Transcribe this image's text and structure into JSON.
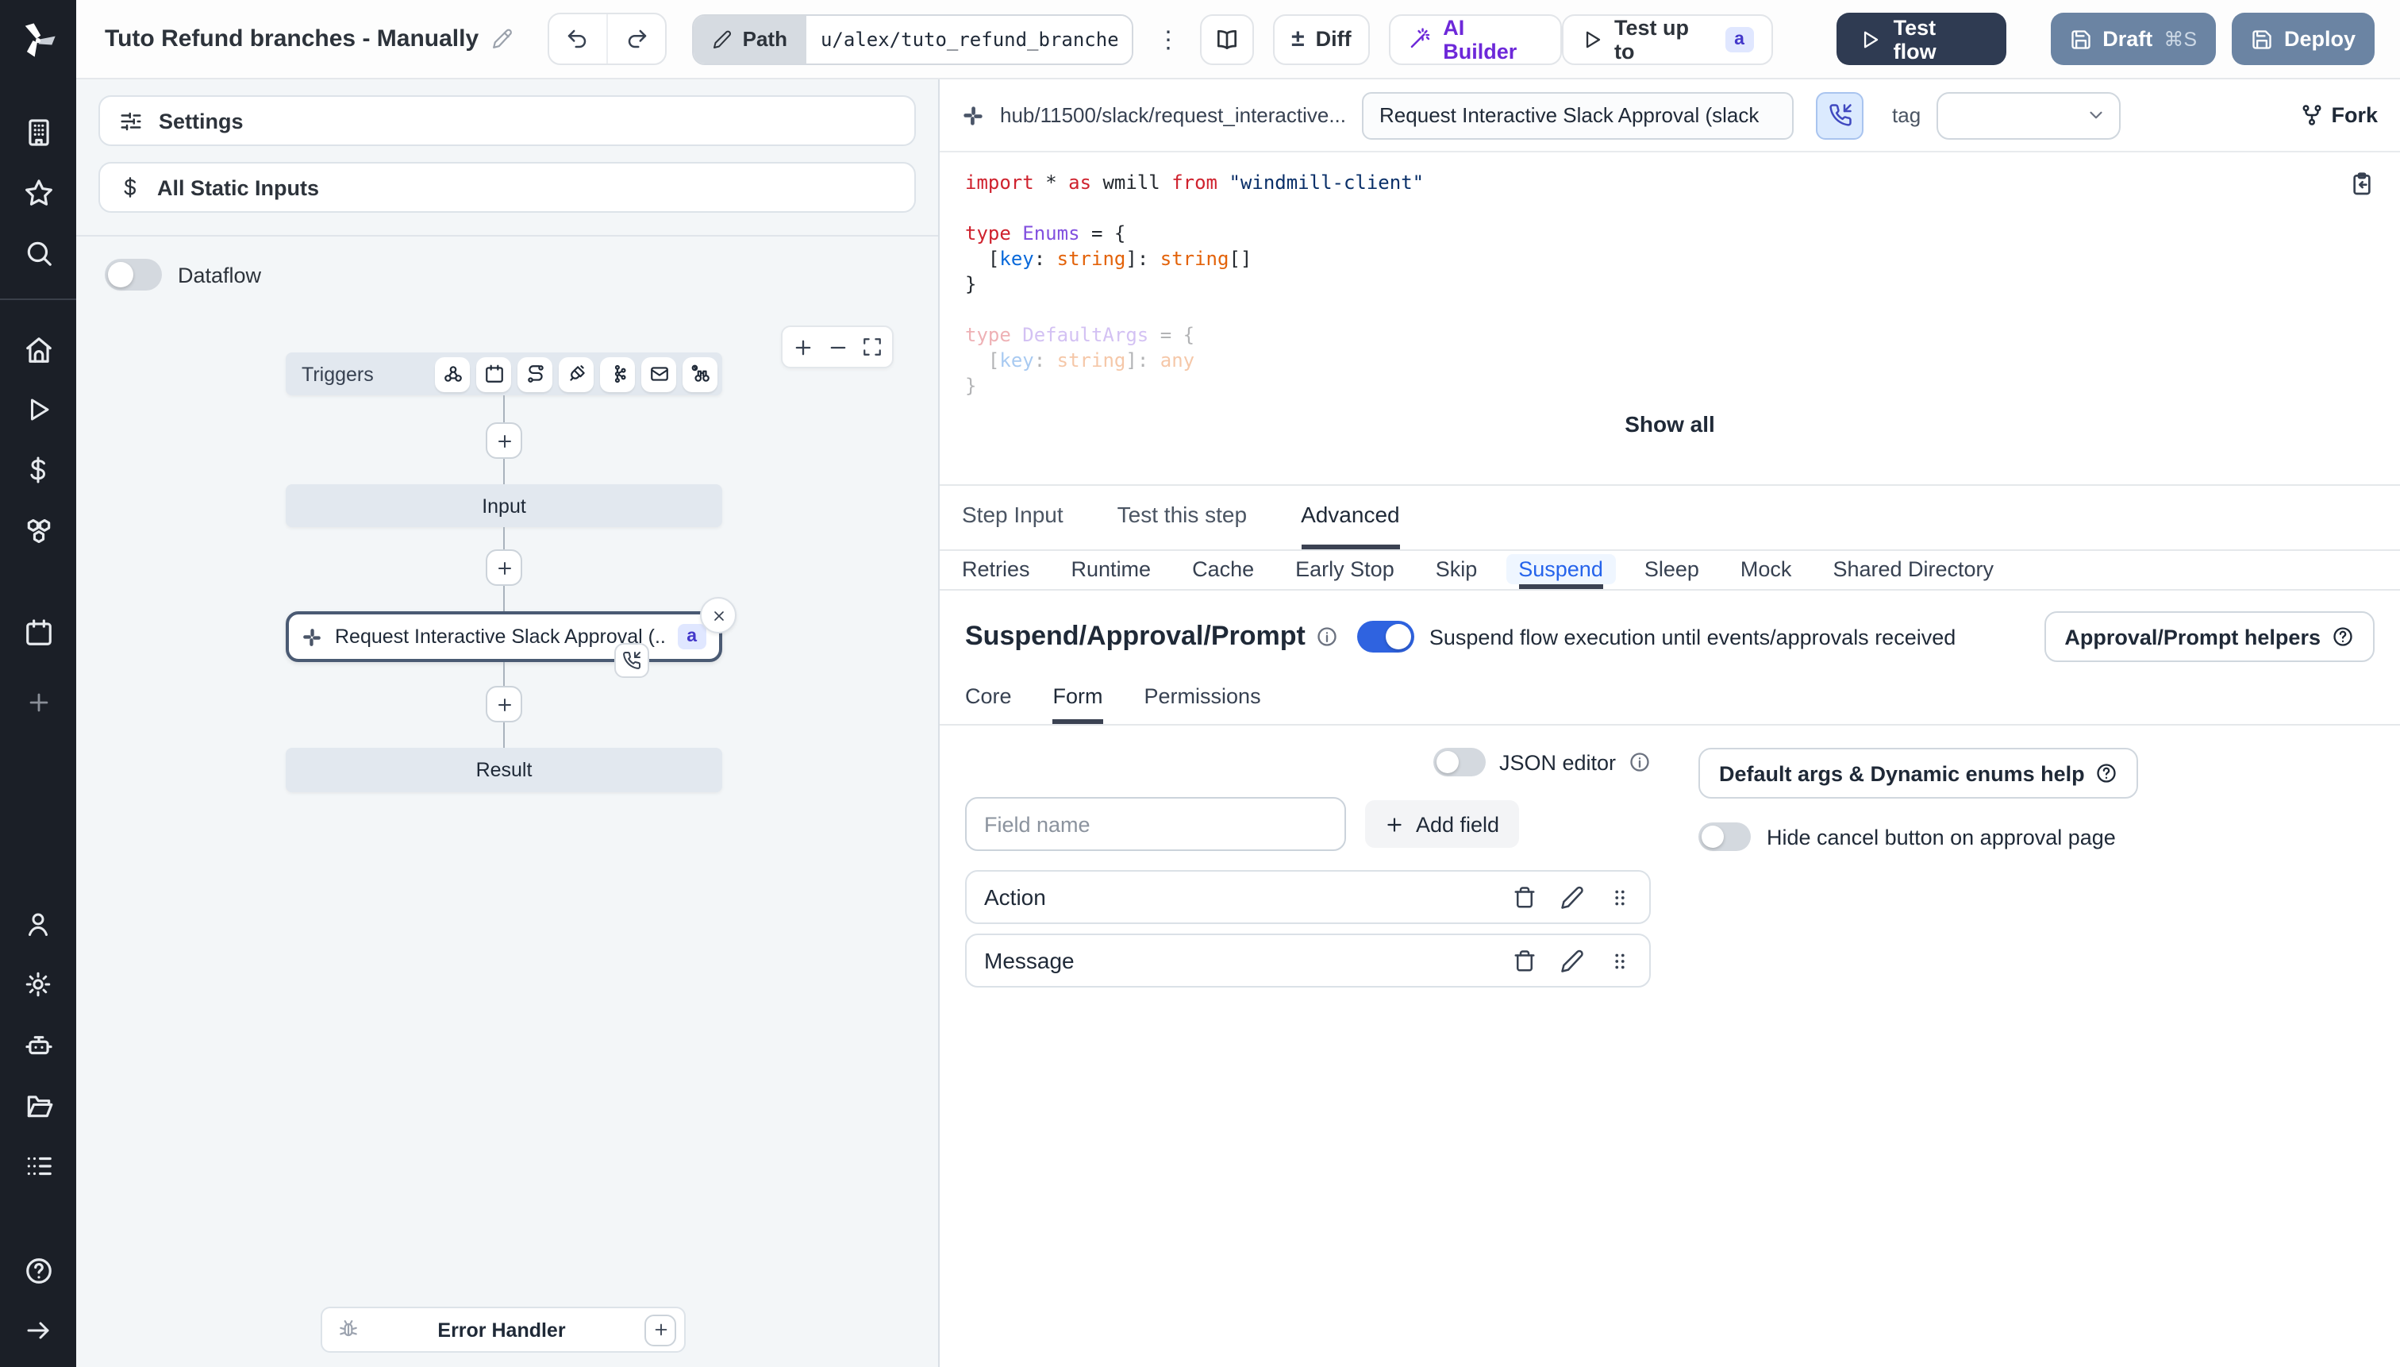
{
  "header": {
    "title": "Tuto Refund branches - Manually",
    "path_label": "Path",
    "path_value": "u/alex/tuto_refund_branches__",
    "diff_label": "Diff",
    "diff_symbol": "±",
    "kebab_symbol": "⋮",
    "ai_builder_label": "AI Builder",
    "test_up_to_label": "Test up to",
    "test_up_to_badge": "a",
    "test_flow_label": "Test flow",
    "draft_label": "Draft",
    "draft_shortcut": "⌘S",
    "deploy_label": "Deploy"
  },
  "sidebar": {
    "icons": [
      "workspace-building",
      "favorites-star",
      "search",
      "home",
      "runs-play",
      "variables-dollar",
      "resources-boxes",
      "schedules-calendar",
      "add-plus",
      "user",
      "settings-gear",
      "workers-bot",
      "folders",
      "logs-list",
      "help",
      "collapse-arrow-right"
    ]
  },
  "flow_panel": {
    "settings_label": "Settings",
    "static_inputs_label": "All Static Inputs",
    "dataflow_label": "Dataflow",
    "triggers_label": "Triggers",
    "trigger_icons": [
      "webhook",
      "schedule",
      "http-route",
      "websocket",
      "kafka",
      "email",
      "scheduled-poll"
    ],
    "input_node_label": "Input",
    "approval_node_label": "Request Interactive Slack Approval (...",
    "approval_node_badge": "a",
    "result_node_label": "Result",
    "error_handler_label": "Error Handler"
  },
  "editor": {
    "hub_path": "hub/11500/slack/request_interactive...",
    "summary_value": "Request Interactive Slack Approval (slack",
    "tag_label": "tag",
    "fork_label": "Fork",
    "show_all_label": "Show all",
    "code": {
      "language": "typescript",
      "lines": [
        {
          "faded": false,
          "tokens": [
            [
              "import",
              "kw"
            ],
            [
              " ",
              ""
            ],
            [
              "*",
              ""
            ],
            [
              " ",
              ""
            ],
            [
              "as",
              "kw"
            ],
            [
              " wmill ",
              ""
            ],
            [
              "from",
              "kw"
            ],
            [
              " ",
              ""
            ],
            [
              "\"windmill-client\"",
              "str"
            ]
          ]
        },
        {
          "faded": false,
          "tokens": []
        },
        {
          "faded": false,
          "tokens": [
            [
              "type",
              "kw"
            ],
            [
              " ",
              ""
            ],
            [
              "Enums",
              "type"
            ],
            [
              " = {",
              ""
            ]
          ]
        },
        {
          "faded": false,
          "tokens": [
            [
              "  [",
              ""
            ],
            [
              "key",
              "prop"
            ],
            [
              ": ",
              ""
            ],
            [
              "string",
              "b"
            ],
            [
              "]: ",
              ""
            ],
            [
              "string",
              "b"
            ],
            [
              "[]",
              ""
            ]
          ]
        },
        {
          "faded": false,
          "tokens": [
            [
              "}",
              ""
            ]
          ]
        },
        {
          "faded": false,
          "tokens": []
        },
        {
          "faded": true,
          "tokens": [
            [
              "type",
              "kw"
            ],
            [
              " ",
              ""
            ],
            [
              "DefaultArgs",
              "type"
            ],
            [
              " = {",
              ""
            ]
          ]
        },
        {
          "faded": true,
          "tokens": [
            [
              "  [",
              ""
            ],
            [
              "key",
              "prop"
            ],
            [
              ": ",
              ""
            ],
            [
              "string",
              "b"
            ],
            [
              "]: ",
              ""
            ],
            [
              "any",
              "b"
            ]
          ]
        },
        {
          "faded": true,
          "tokens": [
            [
              "}",
              ""
            ]
          ]
        }
      ]
    }
  },
  "tabs": {
    "items": [
      "Step Input",
      "Test this step",
      "Advanced"
    ],
    "active": "Advanced"
  },
  "subtabs": {
    "items": [
      "Retries",
      "Runtime",
      "Cache",
      "Early Stop",
      "Skip",
      "Suspend",
      "Sleep",
      "Mock",
      "Shared Directory"
    ],
    "active": "Suspend"
  },
  "suspend": {
    "title": "Suspend/Approval/Prompt",
    "toggle_on": true,
    "toggle_label": "Suspend flow execution until events/approvals received",
    "helpers_label": "Approval/Prompt helpers"
  },
  "inner_tabs": {
    "items": [
      "Core",
      "Form",
      "Permissions"
    ],
    "active": "Form"
  },
  "form": {
    "json_editor_label": "JSON editor",
    "json_editor_on": false,
    "field_name_placeholder": "Field name",
    "add_field_label": "Add field",
    "default_args_label": "Default args & Dynamic enums help",
    "hide_cancel_label": "Hide cancel button on approval page",
    "hide_cancel_on": false,
    "fields": [
      "Action",
      "Message"
    ]
  },
  "colors": {
    "accent_blue": "#2f63e0",
    "dark_button": "#2f3b52",
    "slate_button": "#6b84a3",
    "ai_purple": "#6d28d9",
    "badge_bg": "#e0e7ff",
    "badge_text": "#4338ca",
    "rail_dark": "#1b1f27",
    "panel_gray": "#f3f6f8",
    "node_gray": "#e2e8ef",
    "selected_border": "#4a5a73",
    "subtab_active": "#2563eb"
  }
}
